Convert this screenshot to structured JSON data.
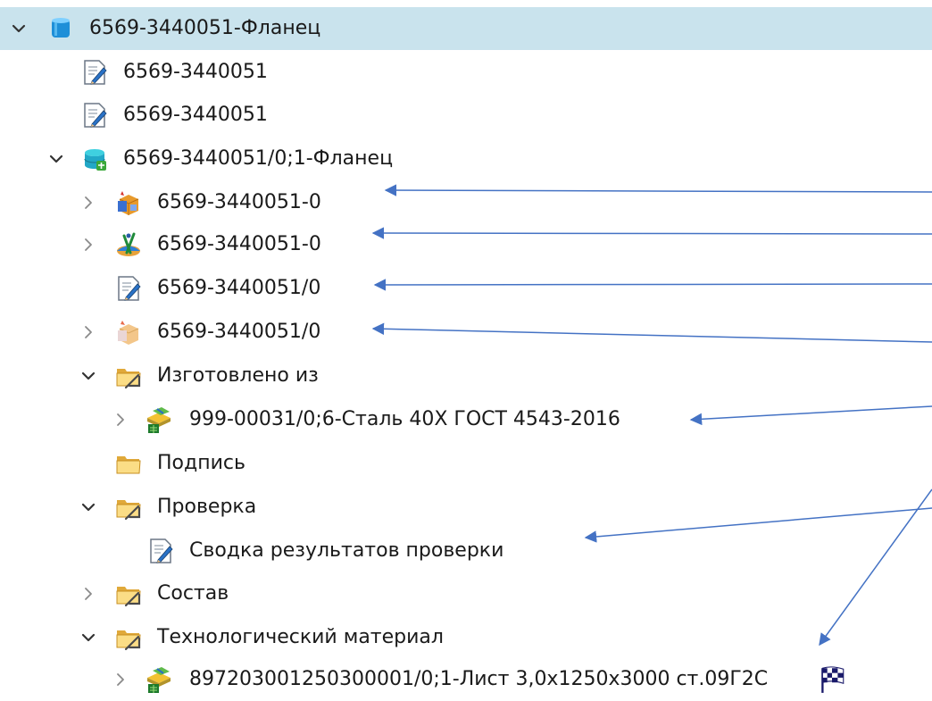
{
  "tree": {
    "root": {
      "label": "6569-3440051-Фланец",
      "icon": "product-cylinder-icon",
      "expanded": true,
      "selected": true
    },
    "doc1": {
      "label": "6569-3440051",
      "icon": "document-edit-icon"
    },
    "doc2": {
      "label": "6569-3440051",
      "icon": "document-edit-icon"
    },
    "revision": {
      "label": "6569-3440051/0;1-Фланец",
      "icon": "revision-db-icon",
      "expanded": true
    },
    "item_a": {
      "label": "6569-3440051-0",
      "icon": "model-box-icon",
      "expanded": false
    },
    "item_b": {
      "label": "6569-3440051-0",
      "icon": "drawing-compass-icon",
      "expanded": false
    },
    "item_c": {
      "label": "6569-3440051/0",
      "icon": "document-edit-icon"
    },
    "item_d": {
      "label": "6569-3440051/0",
      "icon": "model-box-faded-icon",
      "expanded": false
    },
    "folder_made_from": {
      "label": "Изготовлено из",
      "icon": "folder-link-icon",
      "expanded": true
    },
    "material": {
      "label": "999-00031/0;6-Сталь 40Х ГОСТ 4543-2016",
      "icon": "material-icon",
      "expanded": false
    },
    "folder_signature": {
      "label": "Подпись",
      "icon": "folder-icon"
    },
    "folder_check": {
      "label": "Проверка",
      "icon": "folder-link-icon",
      "expanded": true
    },
    "check_summary": {
      "label": "Сводка результатов проверки",
      "icon": "document-edit-icon"
    },
    "folder_composition": {
      "label": "Состав",
      "icon": "folder-link-icon",
      "expanded": false
    },
    "folder_tech_material": {
      "label": "Технологический материал",
      "icon": "folder-link-icon",
      "expanded": true
    },
    "sheet": {
      "label": "897203001250300001/0;1-Лист 3,0x1250x3000 ст.09Г2С",
      "icon": "material-icon",
      "status_icon": "checkered-flag-icon",
      "expanded": false
    }
  },
  "colors": {
    "selection": "#c9e3ed",
    "arrow": "#4472c4",
    "folder": "#e8b84a",
    "chevron": "#404040"
  }
}
